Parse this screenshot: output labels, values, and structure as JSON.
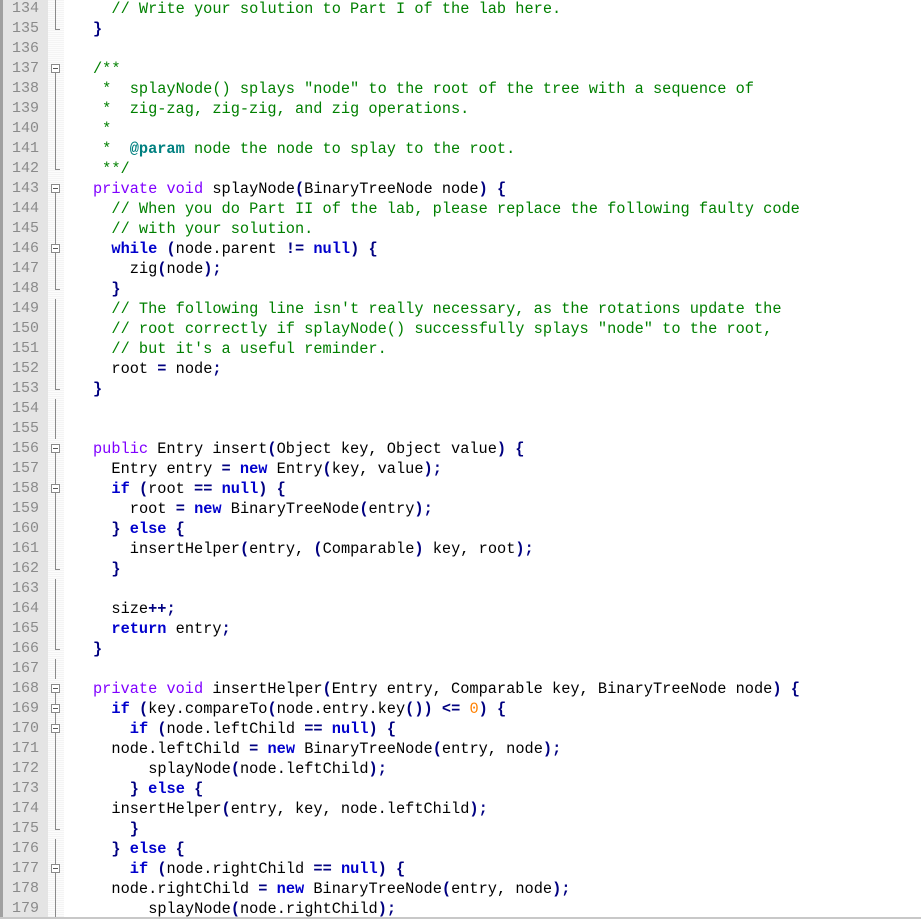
{
  "editor": {
    "language": "java",
    "colors": {
      "keyword": "#0000cc",
      "type_keyword": "#8000ff",
      "comment": "#008000",
      "doc_tag": "#008080",
      "operator": "#000080",
      "number": "#ff8000",
      "line_number": "#8a8a8a",
      "gutter_bg": "#e4e4e4"
    },
    "lines": [
      {
        "n": "134",
        "fold": "line",
        "indent": 2,
        "tokens": [
          [
            "cm",
            "// Write your solution to Part I of the lab here."
          ]
        ]
      },
      {
        "n": "135",
        "fold": "end",
        "indent": 1,
        "tokens": [
          [
            "op",
            "}"
          ]
        ]
      },
      {
        "n": "136",
        "fold": "none",
        "indent": 0,
        "tokens": []
      },
      {
        "n": "137",
        "fold": "start",
        "indent": 1,
        "tokens": [
          [
            "cm",
            "/**"
          ]
        ]
      },
      {
        "n": "138",
        "fold": "line",
        "indent": 1,
        "tokens": [
          [
            "cm",
            " *  splayNode() splays \"node\" to the root of the tree with a sequence of"
          ]
        ]
      },
      {
        "n": "139",
        "fold": "line",
        "indent": 1,
        "tokens": [
          [
            "cm",
            " *  zig-zag, zig-zig, and zig operations."
          ]
        ]
      },
      {
        "n": "140",
        "fold": "line",
        "indent": 1,
        "tokens": [
          [
            "cm",
            " *"
          ]
        ]
      },
      {
        "n": "141",
        "fold": "line",
        "indent": 1,
        "tokens": [
          [
            "cm",
            " *  "
          ],
          [
            "tag",
            "@param"
          ],
          [
            "cm",
            " node the node to splay to the root."
          ]
        ]
      },
      {
        "n": "142",
        "fold": "end",
        "indent": 1,
        "tokens": [
          [
            "cm",
            " **/"
          ]
        ]
      },
      {
        "n": "143",
        "fold": "start",
        "indent": 1,
        "tokens": [
          [
            "kw2",
            "private"
          ],
          [
            "t",
            " "
          ],
          [
            "kw2",
            "void"
          ],
          [
            "t",
            " splayNode"
          ],
          [
            "op",
            "("
          ],
          [
            "t",
            "BinaryTreeNode node"
          ],
          [
            "op",
            ")"
          ],
          [
            "t",
            " "
          ],
          [
            "op",
            "{"
          ]
        ]
      },
      {
        "n": "144",
        "fold": "line",
        "indent": 2,
        "tokens": [
          [
            "cm",
            "// When you do Part II of the lab, please replace the following faulty code"
          ]
        ]
      },
      {
        "n": "145",
        "fold": "line",
        "indent": 2,
        "tokens": [
          [
            "cm",
            "// with your solution."
          ]
        ]
      },
      {
        "n": "146",
        "fold": "start-inner",
        "indent": 2,
        "tokens": [
          [
            "kw",
            "while"
          ],
          [
            "t",
            " "
          ],
          [
            "op",
            "("
          ],
          [
            "t",
            "node.parent "
          ],
          [
            "op",
            "!="
          ],
          [
            "t",
            " "
          ],
          [
            "kw",
            "null"
          ],
          [
            "op",
            ")"
          ],
          [
            "t",
            " "
          ],
          [
            "op",
            "{"
          ]
        ]
      },
      {
        "n": "147",
        "fold": "line",
        "indent": 3,
        "tokens": [
          [
            "t",
            "zig"
          ],
          [
            "op",
            "("
          ],
          [
            "t",
            "node"
          ],
          [
            "op",
            ");"
          ]
        ]
      },
      {
        "n": "148",
        "fold": "end",
        "indent": 2,
        "tokens": [
          [
            "op",
            "}"
          ]
        ]
      },
      {
        "n": "149",
        "fold": "line",
        "indent": 2,
        "tokens": [
          [
            "cm",
            "// The following line isn't really necessary, as the rotations update the"
          ]
        ]
      },
      {
        "n": "150",
        "fold": "line",
        "indent": 2,
        "tokens": [
          [
            "cm",
            "// root correctly if splayNode() successfully splays \"node\" to the root,"
          ]
        ]
      },
      {
        "n": "151",
        "fold": "line",
        "indent": 2,
        "tokens": [
          [
            "cm",
            "// but it's a useful reminder."
          ]
        ]
      },
      {
        "n": "152",
        "fold": "line",
        "indent": 2,
        "tokens": [
          [
            "t",
            "root "
          ],
          [
            "op",
            "="
          ],
          [
            "t",
            " node"
          ],
          [
            "op",
            ";"
          ]
        ]
      },
      {
        "n": "153",
        "fold": "end",
        "indent": 1,
        "tokens": [
          [
            "op",
            "}"
          ]
        ]
      },
      {
        "n": "154",
        "fold": "line",
        "indent": 0,
        "tokens": []
      },
      {
        "n": "155",
        "fold": "line",
        "indent": 0,
        "tokens": []
      },
      {
        "n": "156",
        "fold": "start",
        "indent": 1,
        "tokens": [
          [
            "kw2",
            "public"
          ],
          [
            "t",
            " Entry insert"
          ],
          [
            "op",
            "("
          ],
          [
            "t",
            "Object key, Object value"
          ],
          [
            "op",
            ")"
          ],
          [
            "t",
            " "
          ],
          [
            "op",
            "{"
          ]
        ]
      },
      {
        "n": "157",
        "fold": "line",
        "indent": 2,
        "tokens": [
          [
            "t",
            "Entry entry "
          ],
          [
            "op",
            "="
          ],
          [
            "t",
            " "
          ],
          [
            "kw",
            "new"
          ],
          [
            "t",
            " Entry"
          ],
          [
            "op",
            "("
          ],
          [
            "t",
            "key, value"
          ],
          [
            "op",
            ");"
          ]
        ]
      },
      {
        "n": "158",
        "fold": "start-inner",
        "indent": 2,
        "tokens": [
          [
            "kw",
            "if"
          ],
          [
            "t",
            " "
          ],
          [
            "op",
            "("
          ],
          [
            "t",
            "root "
          ],
          [
            "op",
            "=="
          ],
          [
            "t",
            " "
          ],
          [
            "kw",
            "null"
          ],
          [
            "op",
            ")"
          ],
          [
            "t",
            " "
          ],
          [
            "op",
            "{"
          ]
        ]
      },
      {
        "n": "159",
        "fold": "line",
        "indent": 3,
        "tokens": [
          [
            "t",
            "root "
          ],
          [
            "op",
            "="
          ],
          [
            "t",
            " "
          ],
          [
            "kw",
            "new"
          ],
          [
            "t",
            " BinaryTreeNode"
          ],
          [
            "op",
            "("
          ],
          [
            "t",
            "entry"
          ],
          [
            "op",
            ");"
          ]
        ]
      },
      {
        "n": "160",
        "fold": "line",
        "indent": 2,
        "tokens": [
          [
            "op",
            "}"
          ],
          [
            "t",
            " "
          ],
          [
            "kw",
            "else"
          ],
          [
            "t",
            " "
          ],
          [
            "op",
            "{"
          ]
        ]
      },
      {
        "n": "161",
        "fold": "line",
        "indent": 3,
        "tokens": [
          [
            "t",
            "insertHelper"
          ],
          [
            "op",
            "("
          ],
          [
            "t",
            "entry, "
          ],
          [
            "op",
            "("
          ],
          [
            "t",
            "Comparable"
          ],
          [
            "op",
            ")"
          ],
          [
            "t",
            " key, root"
          ],
          [
            "op",
            ");"
          ]
        ]
      },
      {
        "n": "162",
        "fold": "end",
        "indent": 2,
        "tokens": [
          [
            "op",
            "}"
          ]
        ]
      },
      {
        "n": "163",
        "fold": "line",
        "indent": 0,
        "tokens": []
      },
      {
        "n": "164",
        "fold": "line",
        "indent": 2,
        "tokens": [
          [
            "t",
            "size"
          ],
          [
            "op",
            "++;"
          ]
        ]
      },
      {
        "n": "165",
        "fold": "line",
        "indent": 2,
        "tokens": [
          [
            "kw",
            "return"
          ],
          [
            "t",
            " entry"
          ],
          [
            "op",
            ";"
          ]
        ]
      },
      {
        "n": "166",
        "fold": "end",
        "indent": 1,
        "tokens": [
          [
            "op",
            "}"
          ]
        ]
      },
      {
        "n": "167",
        "fold": "line",
        "indent": 0,
        "tokens": []
      },
      {
        "n": "168",
        "fold": "start",
        "indent": 1,
        "tokens": [
          [
            "kw2",
            "private"
          ],
          [
            "t",
            " "
          ],
          [
            "kw2",
            "void"
          ],
          [
            "t",
            " insertHelper"
          ],
          [
            "op",
            "("
          ],
          [
            "t",
            "Entry entry, Comparable key, BinaryTreeNode node"
          ],
          [
            "op",
            ")"
          ],
          [
            "t",
            " "
          ],
          [
            "op",
            "{"
          ]
        ]
      },
      {
        "n": "169",
        "fold": "start-inner",
        "indent": 2,
        "tokens": [
          [
            "kw",
            "if"
          ],
          [
            "t",
            " "
          ],
          [
            "op",
            "("
          ],
          [
            "t",
            "key.compareTo"
          ],
          [
            "op",
            "("
          ],
          [
            "t",
            "node.entry.key"
          ],
          [
            "op",
            "())"
          ],
          [
            "t",
            " "
          ],
          [
            "op",
            "<="
          ],
          [
            "t",
            " "
          ],
          [
            "num",
            "0"
          ],
          [
            "op",
            ")"
          ],
          [
            "t",
            " "
          ],
          [
            "op",
            "{"
          ]
        ]
      },
      {
        "n": "170",
        "fold": "start-inner",
        "indent": 3,
        "tokens": [
          [
            "kw",
            "if"
          ],
          [
            "t",
            " "
          ],
          [
            "op",
            "("
          ],
          [
            "t",
            "node.leftChild "
          ],
          [
            "op",
            "=="
          ],
          [
            "t",
            " "
          ],
          [
            "kw",
            "null"
          ],
          [
            "op",
            ")"
          ],
          [
            "t",
            " "
          ],
          [
            "op",
            "{"
          ]
        ]
      },
      {
        "n": "171",
        "fold": "line",
        "indent": 2,
        "tokens": [
          [
            "t",
            "node.leftChild "
          ],
          [
            "op",
            "="
          ],
          [
            "t",
            " "
          ],
          [
            "kw",
            "new"
          ],
          [
            "t",
            " BinaryTreeNode"
          ],
          [
            "op",
            "("
          ],
          [
            "t",
            "entry, node"
          ],
          [
            "op",
            ");"
          ]
        ]
      },
      {
        "n": "172",
        "fold": "line",
        "indent": 4,
        "tokens": [
          [
            "t",
            "splayNode"
          ],
          [
            "op",
            "("
          ],
          [
            "t",
            "node.leftChild"
          ],
          [
            "op",
            ");"
          ]
        ]
      },
      {
        "n": "173",
        "fold": "line",
        "indent": 3,
        "tokens": [
          [
            "op",
            "}"
          ],
          [
            "t",
            " "
          ],
          [
            "kw",
            "else"
          ],
          [
            "t",
            " "
          ],
          [
            "op",
            "{"
          ]
        ]
      },
      {
        "n": "174",
        "fold": "line",
        "indent": 2,
        "tokens": [
          [
            "t",
            "insertHelper"
          ],
          [
            "op",
            "("
          ],
          [
            "t",
            "entry, key, node.leftChild"
          ],
          [
            "op",
            ");"
          ]
        ]
      },
      {
        "n": "175",
        "fold": "end",
        "indent": 3,
        "tokens": [
          [
            "op",
            "}"
          ]
        ]
      },
      {
        "n": "176",
        "fold": "line",
        "indent": 2,
        "tokens": [
          [
            "op",
            "}"
          ],
          [
            "t",
            " "
          ],
          [
            "kw",
            "else"
          ],
          [
            "t",
            " "
          ],
          [
            "op",
            "{"
          ]
        ]
      },
      {
        "n": "177",
        "fold": "start-inner",
        "indent": 3,
        "tokens": [
          [
            "kw",
            "if"
          ],
          [
            "t",
            " "
          ],
          [
            "op",
            "("
          ],
          [
            "t",
            "node.rightChild "
          ],
          [
            "op",
            "=="
          ],
          [
            "t",
            " "
          ],
          [
            "kw",
            "null"
          ],
          [
            "op",
            ")"
          ],
          [
            "t",
            " "
          ],
          [
            "op",
            "{"
          ]
        ]
      },
      {
        "n": "178",
        "fold": "line",
        "indent": 2,
        "tokens": [
          [
            "t",
            "node.rightChild "
          ],
          [
            "op",
            "="
          ],
          [
            "t",
            " "
          ],
          [
            "kw",
            "new"
          ],
          [
            "t",
            " BinaryTreeNode"
          ],
          [
            "op",
            "("
          ],
          [
            "t",
            "entry, node"
          ],
          [
            "op",
            ");"
          ]
        ]
      },
      {
        "n": "179",
        "fold": "line",
        "indent": 4,
        "tokens": [
          [
            "t",
            "splayNode"
          ],
          [
            "op",
            "("
          ],
          [
            "t",
            "node.rightChild"
          ],
          [
            "op",
            ");"
          ]
        ]
      }
    ]
  }
}
